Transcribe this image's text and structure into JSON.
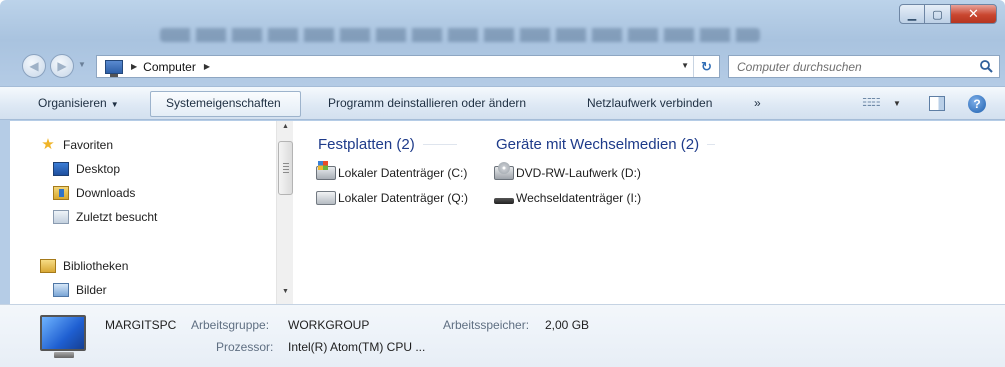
{
  "window": {
    "caption": {
      "minimize": "▁",
      "maximize": "▢",
      "close": "✕"
    }
  },
  "address": {
    "breadcrumb": [
      "Computer"
    ],
    "search_placeholder": "Computer durchsuchen"
  },
  "commandbar": {
    "items": [
      "Organisieren",
      "Systemeigenschaften",
      "Programm deinstallieren oder ändern",
      "Netzlaufwerk verbinden",
      "»"
    ]
  },
  "navigation": {
    "favorites_header": "Favoriten",
    "favorites": [
      "Desktop",
      "Downloads",
      "Zuletzt besucht"
    ],
    "libraries_header": "Bibliotheken",
    "libraries": [
      "Bilder"
    ]
  },
  "content": {
    "groups": [
      {
        "title": "Festplatten (2)",
        "items": [
          "Lokaler Datenträger (C:)",
          "Lokaler Datenträger (Q:)"
        ]
      },
      {
        "title": "Geräte mit Wechselmedien (2)",
        "items": [
          "DVD-RW-Laufwerk (D:)",
          "Wechseldatenträger (I:)"
        ]
      }
    ]
  },
  "details": {
    "computer_name": "MARGITSPC",
    "workgroup_label": "Arbeitsgruppe:",
    "workgroup_value": "WORKGROUP",
    "memory_label": "Arbeitsspeicher:",
    "memory_value": "2,00 GB",
    "processor_label": "Prozessor:",
    "processor_value": "Intel(R) Atom(TM) CPU ..."
  },
  "colors": {
    "accent_header": "#1e3b8a",
    "close_button": "#c9462f"
  },
  "icons": [
    "back-arrow-icon",
    "forward-arrow-icon",
    "computer-icon",
    "refresh-icon",
    "search-icon",
    "view-options-icon",
    "preview-pane-icon",
    "help-icon",
    "star-icon",
    "desktop-icon",
    "downloads-icon",
    "recent-places-icon",
    "library-icon",
    "pictures-icon",
    "system-drive-icon",
    "hard-drive-icon",
    "dvd-drive-icon",
    "removable-drive-icon",
    "monitor-icon"
  ]
}
